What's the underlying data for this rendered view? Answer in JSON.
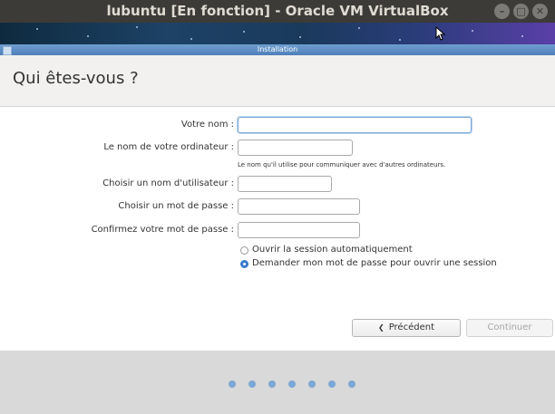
{
  "window": {
    "title": "lubuntu [En fonction] - Oracle VM VirtualBox",
    "controls": [
      "minimize-icon",
      "maximize-icon",
      "close-icon"
    ]
  },
  "installer": {
    "title": "Installation"
  },
  "page": {
    "heading": "Qui êtes-vous ?"
  },
  "form": {
    "name_label": "Votre nom :",
    "name_value": "",
    "computer_label": "Le nom de votre ordinateur :",
    "computer_value": "",
    "computer_hint": "Le nom qu'il utilise pour communiquer avec d'autres ordinateurs.",
    "username_label": "Choisir un nom d'utilisateur :",
    "username_value": "",
    "password_label": "Choisir un mot de passe :",
    "password_value": "",
    "confirm_label": "Confirmez votre mot de passe :",
    "confirm_value": ""
  },
  "login_options": [
    {
      "label": "Ouvrir la session automatiquement",
      "selected": false
    },
    {
      "label": "Demander mon mot de passe pour ouvrir une session",
      "selected": true
    }
  ],
  "buttons": {
    "back_label": "Précédent",
    "continue_label": "Continuer"
  },
  "progress": {
    "steps": 7,
    "color": "#7aa7d6"
  },
  "colors": {
    "title_bar": "#3c3b37",
    "installer_bar": "#5f8fc4",
    "focus": "#7aa7d6",
    "radio_selected": "#3b7bc8"
  }
}
